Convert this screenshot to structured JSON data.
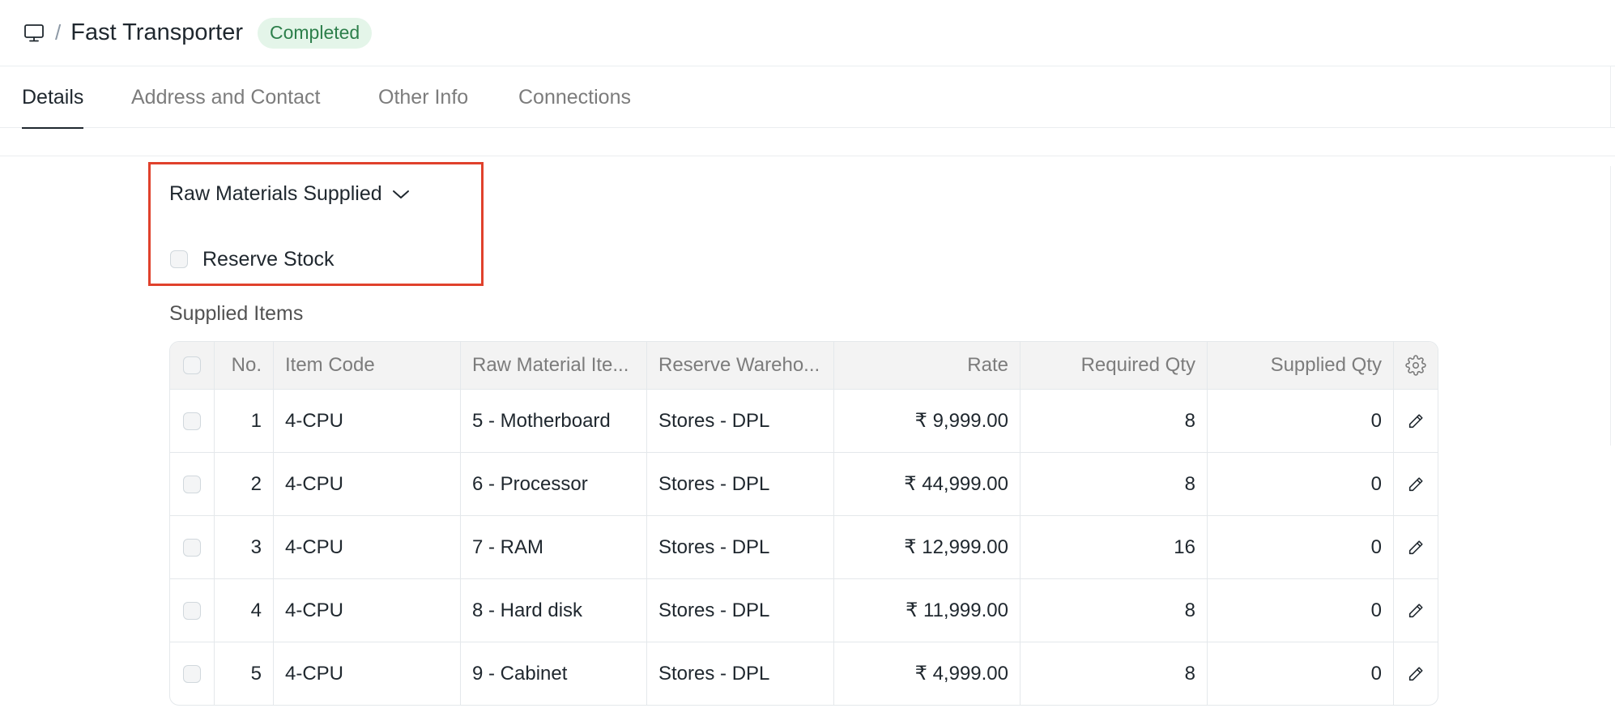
{
  "header": {
    "breadcrumb_icon": "monitor-icon",
    "separator": "/",
    "title": "Fast Transporter",
    "status": "Completed",
    "status_color": "#2d7f4b"
  },
  "tabs": [
    {
      "label": "Details",
      "active": true
    },
    {
      "label": "Address and Contact",
      "active": false
    },
    {
      "label": "Other Info",
      "active": false
    },
    {
      "label": "Connections",
      "active": false
    }
  ],
  "section": {
    "title": "Raw Materials Supplied",
    "reserve_stock_label": "Reserve Stock",
    "reserve_stock_checked": false
  },
  "supplied_items": {
    "label": "Supplied Items",
    "columns": [
      "No.",
      "Item Code",
      "Raw Material Ite...",
      "Reserve Wareho...",
      "Rate",
      "Required Qty",
      "Supplied Qty"
    ],
    "rows": [
      {
        "no": "1",
        "item_code": "4-CPU",
        "raw_material": "5 - Motherboard",
        "warehouse": "Stores - DPL",
        "rate": "₹ 9,999.00",
        "required_qty": "8",
        "supplied_qty": "0"
      },
      {
        "no": "2",
        "item_code": "4-CPU",
        "raw_material": "6 - Processor",
        "warehouse": "Stores - DPL",
        "rate": "₹ 44,999.00",
        "required_qty": "8",
        "supplied_qty": "0"
      },
      {
        "no": "3",
        "item_code": "4-CPU",
        "raw_material": "7 - RAM",
        "warehouse": "Stores - DPL",
        "rate": "₹ 12,999.00",
        "required_qty": "16",
        "supplied_qty": "0"
      },
      {
        "no": "4",
        "item_code": "4-CPU",
        "raw_material": "8 - Hard disk",
        "warehouse": "Stores - DPL",
        "rate": "₹ 11,999.00",
        "required_qty": "8",
        "supplied_qty": "0"
      },
      {
        "no": "5",
        "item_code": "4-CPU",
        "raw_material": "9 - Cabinet",
        "warehouse": "Stores - DPL",
        "rate": "₹ 4,999.00",
        "required_qty": "8",
        "supplied_qty": "0"
      }
    ]
  },
  "colors": {
    "highlight_border": "#e0412c",
    "badge_bg": "#e4f5e9"
  }
}
